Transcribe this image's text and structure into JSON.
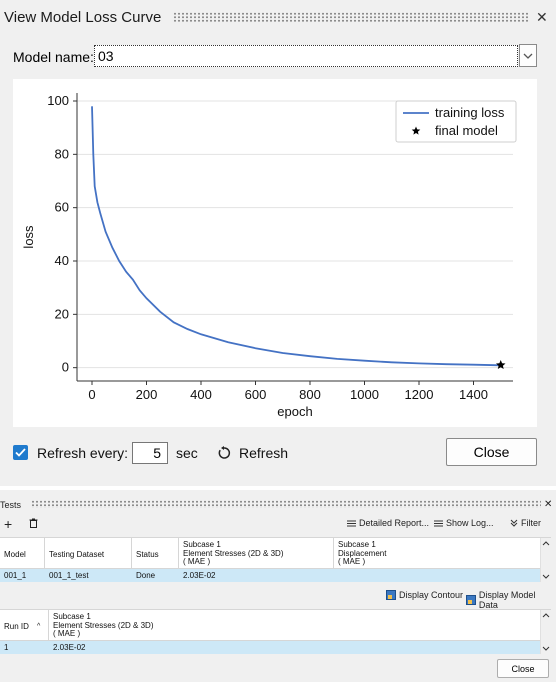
{
  "dialog": {
    "title": "View Model Loss Curve",
    "close_glyph": "✕",
    "model_name_label": "Model name:",
    "model_name_value": "03",
    "refresh_label": "Refresh every:",
    "refresh_checked": true,
    "refresh_interval": "5",
    "refresh_unit": "sec",
    "refresh_button": "Refresh",
    "close_button": "Close"
  },
  "chart_data": {
    "type": "line",
    "xlabel": "epoch",
    "ylabel": "loss",
    "xlim": [
      -55,
      1545
    ],
    "ylim": [
      -5,
      103
    ],
    "xticks": [
      "0",
      "200",
      "400",
      "600",
      "800",
      "1000",
      "1200",
      "1400"
    ],
    "xtick_values": [
      0,
      200,
      400,
      600,
      800,
      1000,
      1200,
      1400
    ],
    "yticks": [
      "0",
      "20",
      "40",
      "60",
      "80",
      "100"
    ],
    "ytick_values": [
      0,
      20,
      40,
      60,
      80,
      100
    ],
    "grid": "horizontal",
    "legend_position": "top-right",
    "series": [
      {
        "name": "training loss",
        "color": "#4472c4",
        "x": [
          0,
          5,
          10,
          20,
          30,
          50,
          75,
          100,
          125,
          150,
          175,
          200,
          250,
          300,
          350,
          400,
          450,
          500,
          600,
          700,
          800,
          900,
          1000,
          1100,
          1200,
          1300,
          1400,
          1500
        ],
        "y": [
          98,
          80,
          68,
          62,
          58,
          51,
          45,
          40,
          36,
          33,
          29,
          26,
          21,
          17,
          14.5,
          12.5,
          11,
          9.5,
          7.3,
          5.5,
          4.3,
          3.3,
          2.6,
          2,
          1.6,
          1.3,
          1.1,
          0.9
        ]
      },
      {
        "name": "final model",
        "marker": "star",
        "color": "#000000",
        "x": [
          1500
        ],
        "y": [
          1
        ]
      }
    ]
  },
  "tests": {
    "title": "Tests",
    "close_glyph": "✕",
    "add_glyph": "+",
    "detailed_report": "Detailed Report...",
    "show_log": "Show Log...",
    "filter": "Filter",
    "table1": {
      "headers": [
        "Model",
        "Testing Dataset",
        "Status",
        "Subcase 1\nElement Stresses (2D & 3D)\n( MAE )",
        "Subcase 1\nDisplacement\n( MAE )"
      ],
      "rows": [
        [
          "001_1",
          "001_1_test",
          "Done",
          "2.03E-02",
          ""
        ]
      ]
    },
    "display_contour": "Display Contour",
    "display_model_data": "Display Model Data",
    "table2": {
      "headers": [
        "Run ID",
        "Subcase 1\nElement Stresses (2D & 3D)\n( MAE )"
      ],
      "sort_glyph": "^",
      "rows": [
        [
          "1",
          "2.03E-02"
        ]
      ]
    },
    "close_button": "Close"
  }
}
